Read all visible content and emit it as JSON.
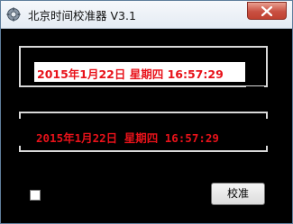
{
  "window": {
    "title": "北京时间校准器 V3.1",
    "app_icon": "gear-icon",
    "close_icon": "close-icon"
  },
  "display": {
    "time_primary": "2015年1月22日 星期四 16:57:29",
    "time_secondary": "2015年1月22日 星期四 16:57:29"
  },
  "controls": {
    "checkbox_checked": false,
    "calibrate_label": "校准"
  },
  "colors": {
    "background": "#000000",
    "time_text": "#e8121a",
    "frame": "#d9d9d9",
    "close_button": "#c95042"
  }
}
